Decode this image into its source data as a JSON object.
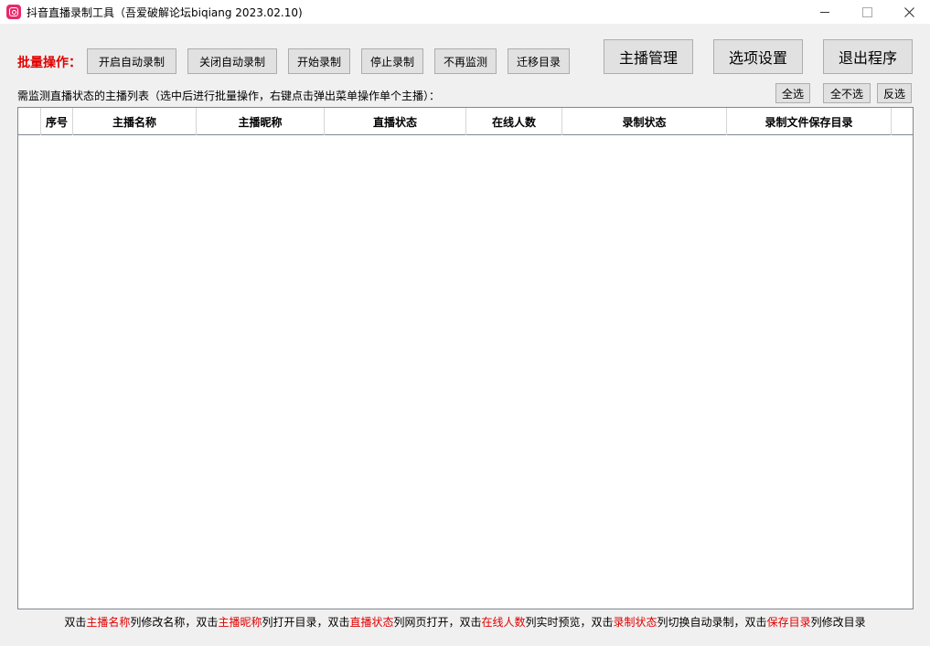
{
  "window": {
    "title": "抖音直播录制工具（吾爱破解论坛biqiang 2023.02.10)"
  },
  "batch": {
    "label": "批量操作：",
    "buttons": [
      "开启自动录制",
      "关闭自动录制",
      "开始录制",
      "停止录制",
      "不再监测",
      "迁移目录"
    ]
  },
  "main_buttons": {
    "anchor_manage": "主播管理",
    "options": "选项设置",
    "exit": "退出程序"
  },
  "list": {
    "caption": "需监测直播状态的主播列表（选中后进行批量操作，右键点击弹出菜单操作单个主播）：",
    "select_all": "全选",
    "select_none": "全不选",
    "invert": "反选",
    "columns": [
      "",
      "序号",
      "主播名称",
      "主播昵称",
      "直播状态",
      "在线人数",
      "录制状态",
      "录制文件保存目录"
    ]
  },
  "footer": {
    "parts": [
      {
        "text": "双击",
        "hl": false
      },
      {
        "text": "主播名称",
        "hl": true
      },
      {
        "text": "列修改名称，双击",
        "hl": false
      },
      {
        "text": "主播昵称",
        "hl": true
      },
      {
        "text": "列打开目录，双击",
        "hl": false
      },
      {
        "text": "直播状态",
        "hl": true
      },
      {
        "text": "列网页打开，双击",
        "hl": false
      },
      {
        "text": "在线人数",
        "hl": true
      },
      {
        "text": "列实时预览，双击",
        "hl": false
      },
      {
        "text": "录制状态",
        "hl": true
      },
      {
        "text": "列切换自动录制，双击",
        "hl": false
      },
      {
        "text": "保存目录",
        "hl": true
      },
      {
        "text": "列修改目录",
        "hl": false
      }
    ]
  },
  "icons": {
    "app": "tiktok-app-icon",
    "minimize": "minimize-icon",
    "maximize": "maximize-icon",
    "close": "close-icon"
  },
  "colors": {
    "accent_red": "#e00000",
    "app_icon": "#e8296a"
  }
}
